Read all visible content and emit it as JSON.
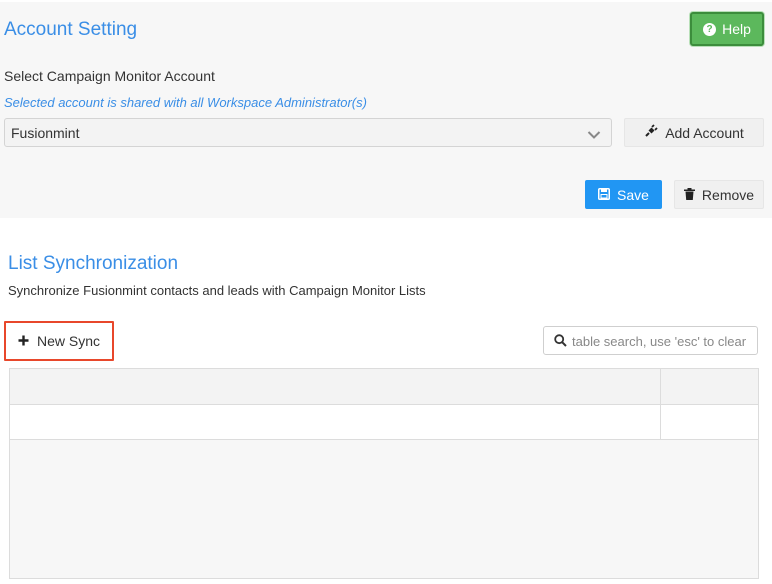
{
  "account": {
    "title": "Account Setting",
    "help_label": "Help",
    "select_label": "Select Campaign Monitor Account",
    "hint": "Selected account is shared with all Workspace Administrator(s)",
    "selected_account": "Fusionmint",
    "add_account_label": "Add Account",
    "save_label": "Save",
    "remove_label": "Remove"
  },
  "sync": {
    "title": "List Synchronization",
    "description": "Synchronize Fusionmint contacts and leads with Campaign Monitor Lists",
    "new_sync_label": "New Sync",
    "search_placeholder": "table search, use 'esc' to clear"
  },
  "colors": {
    "accent_blue": "#3a8ee6",
    "help_green": "#5cb85c",
    "save_blue": "#2196f3",
    "highlight_red": "#e8472b"
  },
  "icons": {
    "help": "question-circle-icon",
    "dropdown": "chevron-down-icon",
    "add_account": "plug-icon",
    "save": "floppy-disk-icon",
    "remove": "trash-icon",
    "new_sync": "plus-icon",
    "search": "search-icon"
  }
}
